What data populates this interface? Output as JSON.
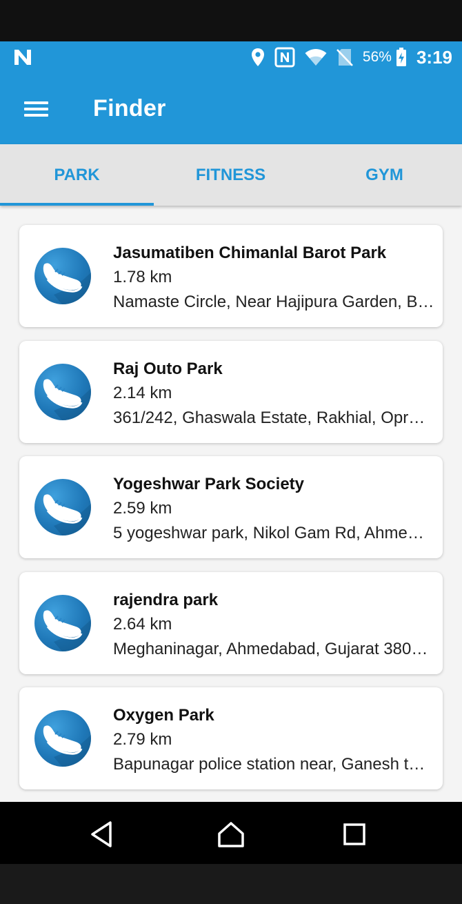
{
  "status_bar": {
    "left_icon": "n-notification-icon",
    "icons": [
      "location-icon",
      "nfc-icon",
      "wifi-icon",
      "no-sim-icon",
      "battery-charging-icon"
    ],
    "battery": "56%",
    "time": "3:19"
  },
  "app_bar": {
    "title": "Finder",
    "menu_icon": "hamburger-menu-icon"
  },
  "tabs": [
    {
      "label": "PARK",
      "selected": true
    },
    {
      "label": "FITNESS",
      "selected": false
    },
    {
      "label": "GYM",
      "selected": false
    }
  ],
  "places": [
    {
      "name": "Jasumatiben Chimanlal Barot Park",
      "distance": "1.78 km",
      "address": "Namaste Circle, Near Hajipura Garden, B…",
      "icon": "running-shoe-icon"
    },
    {
      "name": "Raj Outo Park",
      "distance": "2.14 km",
      "address": "361/242, Ghaswala Estate, Rakhial, Opr…",
      "icon": "running-shoe-icon"
    },
    {
      "name": "Yogeshwar Park Society",
      "distance": "2.59 km",
      "address": "5 yogeshwar park, Nikol Gam Rd, Ahme…",
      "icon": "running-shoe-icon"
    },
    {
      "name": "rajendra park",
      "distance": "2.64 km",
      "address": "Meghaninagar, Ahmedabad, Gujarat 380…",
      "icon": "running-shoe-icon"
    },
    {
      "name": "Oxygen Park",
      "distance": "2.79 km",
      "address": "Bapunagar police station near, Ganesh t…",
      "icon": "running-shoe-icon"
    }
  ],
  "nav_bar": {
    "icons": [
      "back-icon",
      "home-icon",
      "recents-icon"
    ]
  },
  "colors": {
    "primary": "#2196d8",
    "tab_background": "#e4e4e4",
    "list_background": "#f4f4f4"
  }
}
